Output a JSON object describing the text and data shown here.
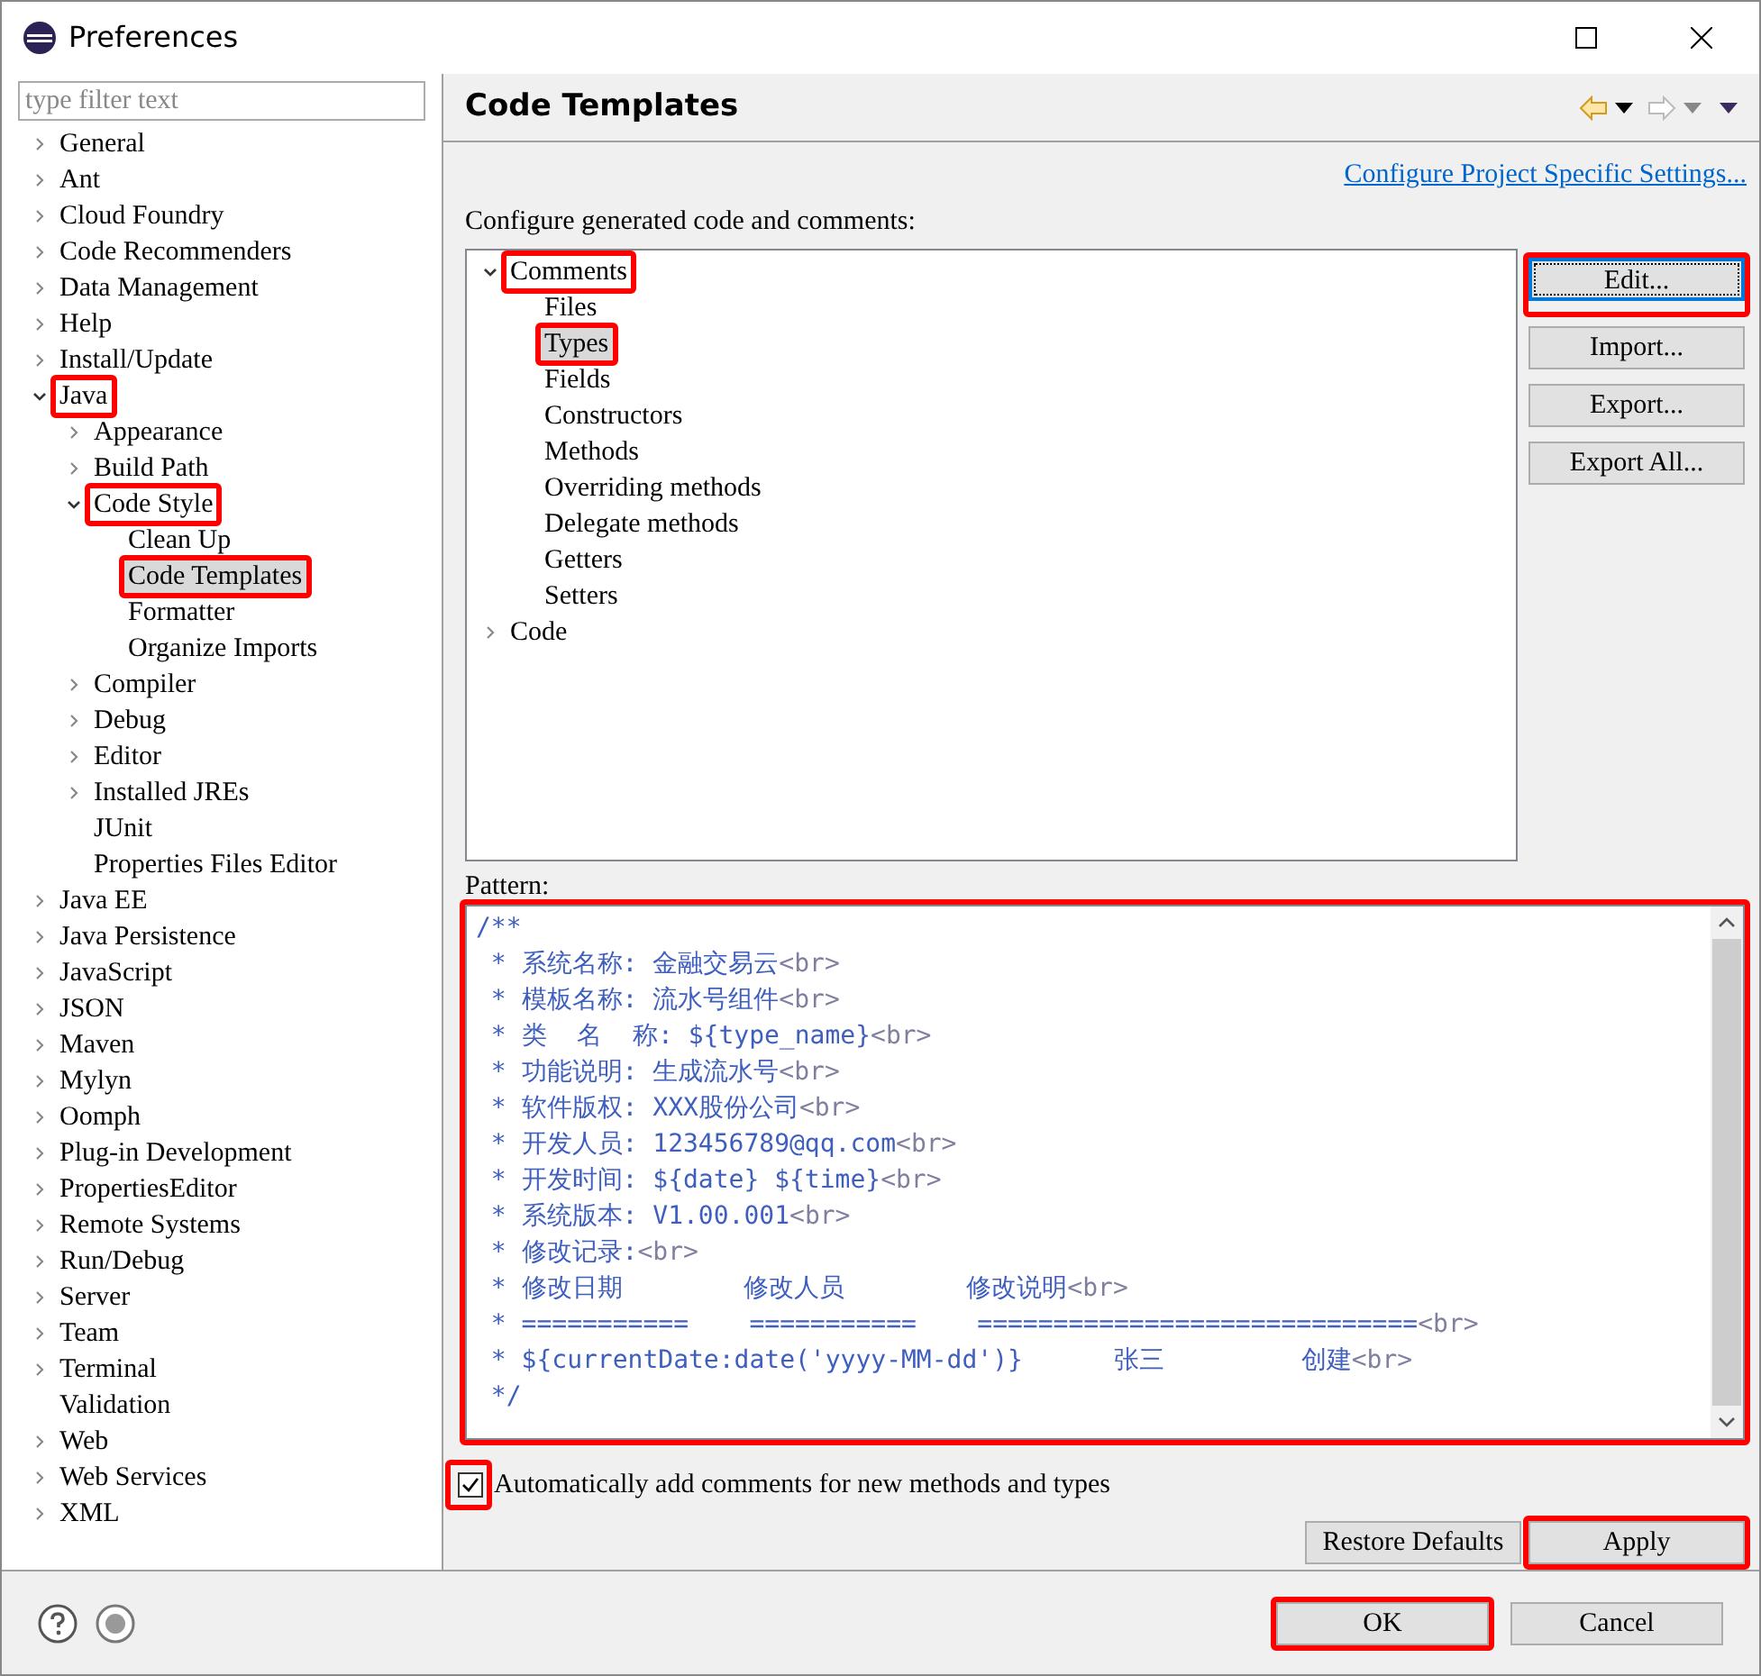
{
  "window": {
    "title": "Preferences"
  },
  "filter": {
    "placeholder": "type filter text"
  },
  "nav_tree": [
    {
      "label": "General",
      "expanded": false,
      "selected": false,
      "annotated": false
    },
    {
      "label": "Ant",
      "expanded": false,
      "selected": false,
      "annotated": false
    },
    {
      "label": "Cloud Foundry",
      "expanded": false,
      "selected": false,
      "annotated": false
    },
    {
      "label": "Code Recommenders",
      "expanded": false,
      "selected": false,
      "annotated": false
    },
    {
      "label": "Data Management",
      "expanded": false,
      "selected": false,
      "annotated": false
    },
    {
      "label": "Help",
      "expanded": false,
      "selected": false,
      "annotated": false
    },
    {
      "label": "Install/Update",
      "expanded": false,
      "selected": false,
      "annotated": false
    },
    {
      "label": "Java",
      "expanded": true,
      "selected": false,
      "annotated": true,
      "children": [
        {
          "label": "Appearance",
          "expanded": false,
          "selected": false,
          "annotated": false
        },
        {
          "label": "Build Path",
          "expanded": false,
          "selected": false,
          "annotated": false
        },
        {
          "label": "Code Style",
          "expanded": true,
          "selected": false,
          "annotated": true,
          "children": [
            {
              "label": "Clean Up",
              "selected": false,
              "annotated": false
            },
            {
              "label": "Code Templates",
              "selected": true,
              "annotated": true
            },
            {
              "label": "Formatter",
              "selected": false,
              "annotated": false
            },
            {
              "label": "Organize Imports",
              "selected": false,
              "annotated": false
            }
          ]
        },
        {
          "label": "Compiler",
          "expanded": false,
          "selected": false,
          "annotated": false
        },
        {
          "label": "Debug",
          "expanded": false,
          "selected": false,
          "annotated": false
        },
        {
          "label": "Editor",
          "expanded": false,
          "selected": false,
          "annotated": false
        },
        {
          "label": "Installed JREs",
          "expanded": false,
          "selected": false,
          "annotated": false
        },
        {
          "label": "JUnit",
          "selected": false,
          "annotated": false
        },
        {
          "label": "Properties Files Editor",
          "selected": false,
          "annotated": false
        }
      ]
    },
    {
      "label": "Java EE",
      "expanded": false,
      "selected": false,
      "annotated": false
    },
    {
      "label": "Java Persistence",
      "expanded": false,
      "selected": false,
      "annotated": false
    },
    {
      "label": "JavaScript",
      "expanded": false,
      "selected": false,
      "annotated": false
    },
    {
      "label": "JSON",
      "expanded": false,
      "selected": false,
      "annotated": false
    },
    {
      "label": "Maven",
      "expanded": false,
      "selected": false,
      "annotated": false
    },
    {
      "label": "Mylyn",
      "expanded": false,
      "selected": false,
      "annotated": false
    },
    {
      "label": "Oomph",
      "expanded": false,
      "selected": false,
      "annotated": false
    },
    {
      "label": "Plug-in Development",
      "expanded": false,
      "selected": false,
      "annotated": false
    },
    {
      "label": "PropertiesEditor",
      "expanded": false,
      "selected": false,
      "annotated": false
    },
    {
      "label": "Remote Systems",
      "expanded": false,
      "selected": false,
      "annotated": false
    },
    {
      "label": "Run/Debug",
      "expanded": false,
      "selected": false,
      "annotated": false
    },
    {
      "label": "Server",
      "expanded": false,
      "selected": false,
      "annotated": false
    },
    {
      "label": "Team",
      "expanded": false,
      "selected": false,
      "annotated": false
    },
    {
      "label": "Terminal",
      "expanded": false,
      "selected": false,
      "annotated": false
    },
    {
      "label": "Validation",
      "selected": false,
      "annotated": false
    },
    {
      "label": "Web",
      "expanded": false,
      "selected": false,
      "annotated": false
    },
    {
      "label": "Web Services",
      "expanded": false,
      "selected": false,
      "annotated": false
    },
    {
      "label": "XML",
      "expanded": false,
      "selected": false,
      "annotated": false
    }
  ],
  "page": {
    "title": "Code Templates",
    "link": "Configure Project Specific Settings...",
    "description": "Configure generated code and comments:"
  },
  "template_tree": [
    {
      "label": "Comments",
      "expanded": true,
      "selected": false,
      "annotated": true,
      "children": [
        {
          "label": "Files",
          "selected": false,
          "annotated": false
        },
        {
          "label": "Types",
          "selected": true,
          "annotated": true
        },
        {
          "label": "Fields",
          "selected": false,
          "annotated": false
        },
        {
          "label": "Constructors",
          "selected": false,
          "annotated": false
        },
        {
          "label": "Methods",
          "selected": false,
          "annotated": false
        },
        {
          "label": "Overriding methods",
          "selected": false,
          "annotated": false
        },
        {
          "label": "Delegate methods",
          "selected": false,
          "annotated": false
        },
        {
          "label": "Getters",
          "selected": false,
          "annotated": false
        },
        {
          "label": "Setters",
          "selected": false,
          "annotated": false
        }
      ]
    },
    {
      "label": "Code",
      "expanded": false,
      "selected": false,
      "annotated": false
    }
  ],
  "side_buttons": [
    {
      "label": "Edit...",
      "focused": true,
      "annotated": true
    },
    {
      "label": "Import...",
      "focused": false,
      "annotated": false
    },
    {
      "label": "Export...",
      "focused": false,
      "annotated": false
    },
    {
      "label": "Export All...",
      "focused": false,
      "annotated": false
    }
  ],
  "pattern": {
    "label": "Pattern:",
    "annotated": true,
    "lines": [
      {
        "text": "/**"
      },
      {
        "text": " * 系统名称: 金融交易云",
        "tag": "<br>"
      },
      {
        "text": " * 模板名称: 流水号组件",
        "tag": "<br>"
      },
      {
        "text": " * 类  名  称: ${type_name}",
        "tag": "<br>"
      },
      {
        "text": " * 功能说明: 生成流水号",
        "tag": "<br>"
      },
      {
        "text": " * 软件版权: XXX股份公司",
        "tag": "<br>"
      },
      {
        "text": " * 开发人员: 123456789@qq.com",
        "tag": "<br>"
      },
      {
        "text": " * 开发时间: ${date} ${time}",
        "tag": "<br>"
      },
      {
        "text": " * 系统版本: V1.00.001",
        "tag": "<br>"
      },
      {
        "text": " * 修改记录:",
        "tag": "<br>"
      },
      {
        "text": " * 修改日期        修改人员        修改说明",
        "tag": "<br>"
      },
      {
        "text": " * ===========    ===========    =============================",
        "tag": "<br>"
      },
      {
        "text": " * ${currentDate:date('yyyy-MM-dd')}      张三         创建",
        "tag": "<br>"
      },
      {
        "text": " */"
      }
    ]
  },
  "auto_comments": {
    "label": "Automatically add comments for new methods and types",
    "checked": true,
    "annotated": true
  },
  "page_buttons": [
    {
      "label": "Restore Defaults",
      "annotated": false
    },
    {
      "label": "Apply",
      "annotated": true
    }
  ],
  "dialog_buttons": [
    {
      "label": "OK",
      "annotated": true
    },
    {
      "label": "Cancel",
      "annotated": false
    }
  ]
}
